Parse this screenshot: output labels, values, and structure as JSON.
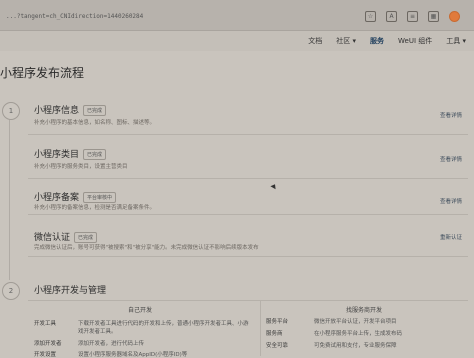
{
  "browser": {
    "url": "...?tangent=ch_CNIdirection=1440260284",
    "icons": [
      "star-icon",
      "font-icon",
      "favorites-icon",
      "apps-icon",
      "profile-icon"
    ]
  },
  "nav": {
    "items": [
      "文档",
      "社区 ▾",
      "服务",
      "WeUI 组件",
      "工具 ▾"
    ]
  },
  "page": {
    "title": "小程序发布流程"
  },
  "steps": [
    {
      "number": "1"
    },
    {
      "number": "2"
    }
  ],
  "cards": [
    {
      "title": "小程序信息",
      "badge": "已完成",
      "desc": "补充小程序的基本信息，如名称、图标、描述等。",
      "link": "查看详情"
    },
    {
      "title": "小程序类目",
      "badge": "已完成",
      "desc": "补充小程序的服务类目，设置主营类目",
      "link": "查看详情"
    },
    {
      "title": "小程序备案",
      "badge": "平台审核中",
      "desc": "补充小程序的备案信息，检测是否满足备案条件。",
      "link": "查看详情"
    },
    {
      "title": "微信认证",
      "badge": "已完成",
      "desc": "完成微信认证后，账号可获得\"被搜索\"和\"被分享\"能力。未完成微信认证不影响后续版本发布",
      "link": "重新认证"
    }
  ],
  "section2": {
    "title": "小程序开发与管理",
    "left_head": "自己开发",
    "right_head": "找服务商开发",
    "left_rows": [
      {
        "label": "开发工具",
        "text": "下载开发者工具进行代码的开发和上传，普通小程序开发者工具、小游戏开发者工具。"
      },
      {
        "label": "添加开发者",
        "text": "添加开发者，进行代码上传"
      },
      {
        "label": "开发设置",
        "text": "设置小程序服务器域名及AppID(小程序ID)等"
      }
    ],
    "right_rows": [
      {
        "label": "服务平台",
        "text": "微信开放平台认证，开发平台项目"
      },
      {
        "label": "服务商",
        "text": "在小程序服务平台上传，生成发布码"
      },
      {
        "label": "安全可靠",
        "text": "可免费试用和支付，专业服务保障"
      }
    ]
  }
}
